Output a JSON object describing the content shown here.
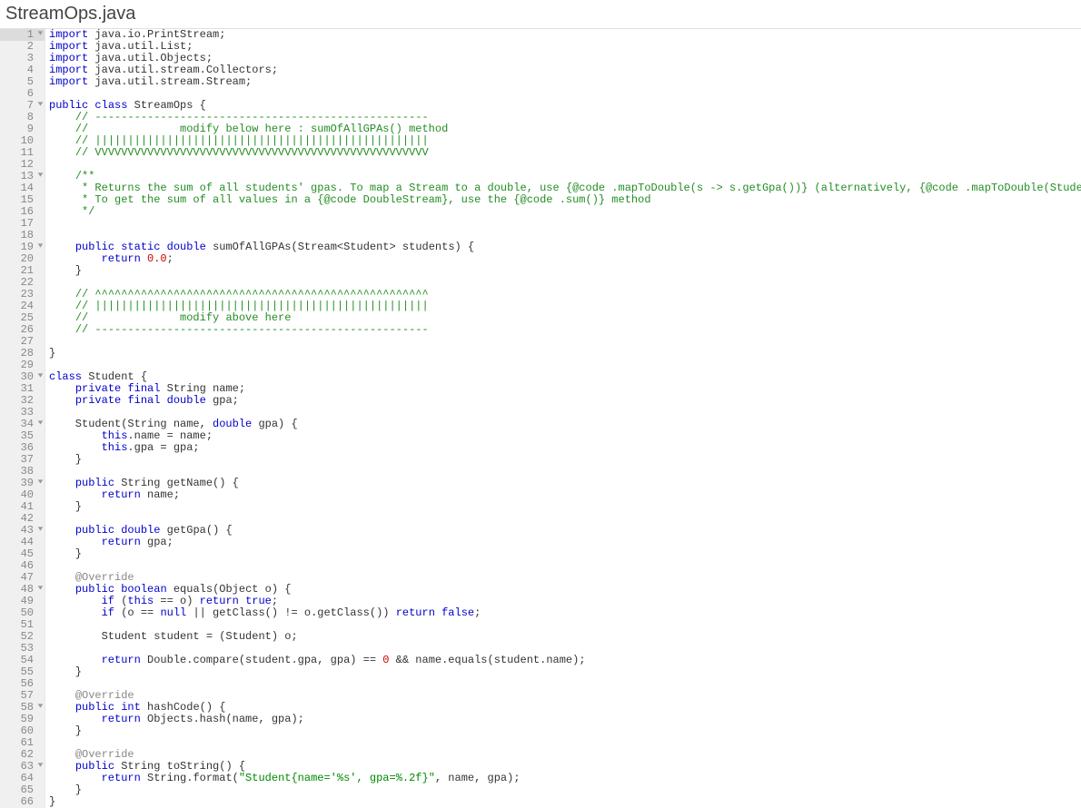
{
  "page_title": "StreamOps.java",
  "active_line": 1,
  "lines": [
    {
      "n": 1,
      "fold": true,
      "tokens": [
        [
          "kw",
          "import"
        ],
        [
          "pl",
          " java.io.PrintStream;"
        ]
      ]
    },
    {
      "n": 2,
      "fold": false,
      "tokens": [
        [
          "kw",
          "import"
        ],
        [
          "pl",
          " java.util.List;"
        ]
      ]
    },
    {
      "n": 3,
      "fold": false,
      "tokens": [
        [
          "kw",
          "import"
        ],
        [
          "pl",
          " java.util.Objects;"
        ]
      ]
    },
    {
      "n": 4,
      "fold": false,
      "tokens": [
        [
          "kw",
          "import"
        ],
        [
          "pl",
          " java.util.stream.Collectors;"
        ]
      ]
    },
    {
      "n": 5,
      "fold": false,
      "tokens": [
        [
          "kw",
          "import"
        ],
        [
          "pl",
          " java.util.stream.Stream;"
        ]
      ]
    },
    {
      "n": 6,
      "fold": false,
      "tokens": []
    },
    {
      "n": 7,
      "fold": true,
      "tokens": [
        [
          "kw",
          "public"
        ],
        [
          "pl",
          " "
        ],
        [
          "kw",
          "class"
        ],
        [
          "pl",
          " StreamOps {"
        ]
      ]
    },
    {
      "n": 8,
      "fold": false,
      "tokens": [
        [
          "pl",
          "    "
        ],
        [
          "cmt",
          "// ---------------------------------------------------"
        ]
      ]
    },
    {
      "n": 9,
      "fold": false,
      "tokens": [
        [
          "pl",
          "    "
        ],
        [
          "cmt",
          "//              modify below here : sumOfAllGPAs() method"
        ]
      ]
    },
    {
      "n": 10,
      "fold": false,
      "tokens": [
        [
          "pl",
          "    "
        ],
        [
          "cmt",
          "// |||||||||||||||||||||||||||||||||||||||||||||||||||"
        ]
      ]
    },
    {
      "n": 11,
      "fold": false,
      "tokens": [
        [
          "pl",
          "    "
        ],
        [
          "cmt",
          "// VVVVVVVVVVVVVVVVVVVVVVVVVVVVVVVVVVVVVVVVVVVVVVVVVVV"
        ]
      ]
    },
    {
      "n": 12,
      "fold": false,
      "tokens": []
    },
    {
      "n": 13,
      "fold": true,
      "tokens": [
        [
          "pl",
          "    "
        ],
        [
          "cmt",
          "/**"
        ]
      ]
    },
    {
      "n": 14,
      "fold": false,
      "tokens": [
        [
          "pl",
          "     "
        ],
        [
          "cmt",
          "* Returns the sum of all students' gpas. To map a Stream to a double, use {@code .mapToDouble(s -> s.getGpa())} (alternatively, {@code .mapToDouble(Student::getGpa)})."
        ]
      ]
    },
    {
      "n": 15,
      "fold": false,
      "tokens": [
        [
          "pl",
          "     "
        ],
        [
          "cmt",
          "* To get the sum of all values in a {@code DoubleStream}, use the {@code .sum()} method"
        ]
      ]
    },
    {
      "n": 16,
      "fold": false,
      "tokens": [
        [
          "pl",
          "     "
        ],
        [
          "cmt",
          "*/"
        ]
      ]
    },
    {
      "n": 17,
      "fold": false,
      "tokens": []
    },
    {
      "n": 18,
      "fold": false,
      "tokens": []
    },
    {
      "n": 19,
      "fold": true,
      "tokens": [
        [
          "pl",
          "    "
        ],
        [
          "kw",
          "public"
        ],
        [
          "pl",
          " "
        ],
        [
          "kw",
          "static"
        ],
        [
          "pl",
          " "
        ],
        [
          "kw",
          "double"
        ],
        [
          "pl",
          " sumOfAllGPAs(Stream<Student> students) {"
        ]
      ]
    },
    {
      "n": 20,
      "fold": false,
      "tokens": [
        [
          "pl",
          "        "
        ],
        [
          "kw",
          "return"
        ],
        [
          "pl",
          " "
        ],
        [
          "num",
          "0.0"
        ],
        [
          "pl",
          ";"
        ]
      ]
    },
    {
      "n": 21,
      "fold": false,
      "tokens": [
        [
          "pl",
          "    }"
        ]
      ]
    },
    {
      "n": 22,
      "fold": false,
      "tokens": []
    },
    {
      "n": 23,
      "fold": false,
      "tokens": [
        [
          "pl",
          "    "
        ],
        [
          "cmt",
          "// ^^^^^^^^^^^^^^^^^^^^^^^^^^^^^^^^^^^^^^^^^^^^^^^^^^^"
        ]
      ]
    },
    {
      "n": 24,
      "fold": false,
      "tokens": [
        [
          "pl",
          "    "
        ],
        [
          "cmt",
          "// |||||||||||||||||||||||||||||||||||||||||||||||||||"
        ]
      ]
    },
    {
      "n": 25,
      "fold": false,
      "tokens": [
        [
          "pl",
          "    "
        ],
        [
          "cmt",
          "//              modify above here"
        ]
      ]
    },
    {
      "n": 26,
      "fold": false,
      "tokens": [
        [
          "pl",
          "    "
        ],
        [
          "cmt",
          "// ---------------------------------------------------"
        ]
      ]
    },
    {
      "n": 27,
      "fold": false,
      "tokens": []
    },
    {
      "n": 28,
      "fold": false,
      "tokens": [
        [
          "pl",
          "}"
        ]
      ]
    },
    {
      "n": 29,
      "fold": false,
      "tokens": []
    },
    {
      "n": 30,
      "fold": true,
      "tokens": [
        [
          "kw",
          "class"
        ],
        [
          "pl",
          " Student {"
        ]
      ]
    },
    {
      "n": 31,
      "fold": false,
      "tokens": [
        [
          "pl",
          "    "
        ],
        [
          "kw",
          "private"
        ],
        [
          "pl",
          " "
        ],
        [
          "kw",
          "final"
        ],
        [
          "pl",
          " String name;"
        ]
      ]
    },
    {
      "n": 32,
      "fold": false,
      "tokens": [
        [
          "pl",
          "    "
        ],
        [
          "kw",
          "private"
        ],
        [
          "pl",
          " "
        ],
        [
          "kw",
          "final"
        ],
        [
          "pl",
          " "
        ],
        [
          "kw",
          "double"
        ],
        [
          "pl",
          " gpa;"
        ]
      ]
    },
    {
      "n": 33,
      "fold": false,
      "tokens": []
    },
    {
      "n": 34,
      "fold": true,
      "tokens": [
        [
          "pl",
          "    Student(String name, "
        ],
        [
          "kw",
          "double"
        ],
        [
          "pl",
          " gpa) {"
        ]
      ]
    },
    {
      "n": 35,
      "fold": false,
      "tokens": [
        [
          "pl",
          "        "
        ],
        [
          "kw",
          "this"
        ],
        [
          "pl",
          ".name = name;"
        ]
      ]
    },
    {
      "n": 36,
      "fold": false,
      "tokens": [
        [
          "pl",
          "        "
        ],
        [
          "kw",
          "this"
        ],
        [
          "pl",
          ".gpa = gpa;"
        ]
      ]
    },
    {
      "n": 37,
      "fold": false,
      "tokens": [
        [
          "pl",
          "    }"
        ]
      ]
    },
    {
      "n": 38,
      "fold": false,
      "tokens": []
    },
    {
      "n": 39,
      "fold": true,
      "tokens": [
        [
          "pl",
          "    "
        ],
        [
          "kw",
          "public"
        ],
        [
          "pl",
          " String getName() {"
        ]
      ]
    },
    {
      "n": 40,
      "fold": false,
      "tokens": [
        [
          "pl",
          "        "
        ],
        [
          "kw",
          "return"
        ],
        [
          "pl",
          " name;"
        ]
      ]
    },
    {
      "n": 41,
      "fold": false,
      "tokens": [
        [
          "pl",
          "    }"
        ]
      ]
    },
    {
      "n": 42,
      "fold": false,
      "tokens": []
    },
    {
      "n": 43,
      "fold": true,
      "tokens": [
        [
          "pl",
          "    "
        ],
        [
          "kw",
          "public"
        ],
        [
          "pl",
          " "
        ],
        [
          "kw",
          "double"
        ],
        [
          "pl",
          " getGpa() {"
        ]
      ]
    },
    {
      "n": 44,
      "fold": false,
      "tokens": [
        [
          "pl",
          "        "
        ],
        [
          "kw",
          "return"
        ],
        [
          "pl",
          " gpa;"
        ]
      ]
    },
    {
      "n": 45,
      "fold": false,
      "tokens": [
        [
          "pl",
          "    }"
        ]
      ]
    },
    {
      "n": 46,
      "fold": false,
      "tokens": []
    },
    {
      "n": 47,
      "fold": false,
      "tokens": [
        [
          "pl",
          "    "
        ],
        [
          "ann",
          "@Override"
        ]
      ]
    },
    {
      "n": 48,
      "fold": true,
      "tokens": [
        [
          "pl",
          "    "
        ],
        [
          "kw",
          "public"
        ],
        [
          "pl",
          " "
        ],
        [
          "kw",
          "boolean"
        ],
        [
          "pl",
          " equals(Object o) {"
        ]
      ]
    },
    {
      "n": 49,
      "fold": false,
      "tokens": [
        [
          "pl",
          "        "
        ],
        [
          "kw",
          "if"
        ],
        [
          "pl",
          " ("
        ],
        [
          "kw",
          "this"
        ],
        [
          "pl",
          " == o) "
        ],
        [
          "kw",
          "return"
        ],
        [
          "pl",
          " "
        ],
        [
          "kw",
          "true"
        ],
        [
          "pl",
          ";"
        ]
      ]
    },
    {
      "n": 50,
      "fold": false,
      "tokens": [
        [
          "pl",
          "        "
        ],
        [
          "kw",
          "if"
        ],
        [
          "pl",
          " (o == "
        ],
        [
          "kw",
          "null"
        ],
        [
          "pl",
          " || getClass() != o.getClass()) "
        ],
        [
          "kw",
          "return"
        ],
        [
          "pl",
          " "
        ],
        [
          "kw",
          "false"
        ],
        [
          "pl",
          ";"
        ]
      ]
    },
    {
      "n": 51,
      "fold": false,
      "tokens": []
    },
    {
      "n": 52,
      "fold": false,
      "tokens": [
        [
          "pl",
          "        Student student = (Student) o;"
        ]
      ]
    },
    {
      "n": 53,
      "fold": false,
      "tokens": []
    },
    {
      "n": 54,
      "fold": false,
      "tokens": [
        [
          "pl",
          "        "
        ],
        [
          "kw",
          "return"
        ],
        [
          "pl",
          " Double.compare(student.gpa, gpa) == "
        ],
        [
          "num",
          "0"
        ],
        [
          "pl",
          " && name.equals(student.name);"
        ]
      ]
    },
    {
      "n": 55,
      "fold": false,
      "tokens": [
        [
          "pl",
          "    }"
        ]
      ]
    },
    {
      "n": 56,
      "fold": false,
      "tokens": []
    },
    {
      "n": 57,
      "fold": false,
      "tokens": [
        [
          "pl",
          "    "
        ],
        [
          "ann",
          "@Override"
        ]
      ]
    },
    {
      "n": 58,
      "fold": true,
      "tokens": [
        [
          "pl",
          "    "
        ],
        [
          "kw",
          "public"
        ],
        [
          "pl",
          " "
        ],
        [
          "kw",
          "int"
        ],
        [
          "pl",
          " hashCode() {"
        ]
      ]
    },
    {
      "n": 59,
      "fold": false,
      "tokens": [
        [
          "pl",
          "        "
        ],
        [
          "kw",
          "return"
        ],
        [
          "pl",
          " Objects.hash(name, gpa);"
        ]
      ]
    },
    {
      "n": 60,
      "fold": false,
      "tokens": [
        [
          "pl",
          "    }"
        ]
      ]
    },
    {
      "n": 61,
      "fold": false,
      "tokens": []
    },
    {
      "n": 62,
      "fold": false,
      "tokens": [
        [
          "pl",
          "    "
        ],
        [
          "ann",
          "@Override"
        ]
      ]
    },
    {
      "n": 63,
      "fold": true,
      "tokens": [
        [
          "pl",
          "    "
        ],
        [
          "kw",
          "public"
        ],
        [
          "pl",
          " String toString() {"
        ]
      ]
    },
    {
      "n": 64,
      "fold": false,
      "tokens": [
        [
          "pl",
          "        "
        ],
        [
          "kw",
          "return"
        ],
        [
          "pl",
          " String.format("
        ],
        [
          "str",
          "\"Student{name='%s', gpa=%.2f}\""
        ],
        [
          "pl",
          ", name, gpa);"
        ]
      ]
    },
    {
      "n": 65,
      "fold": false,
      "tokens": [
        [
          "pl",
          "    }"
        ]
      ]
    },
    {
      "n": 66,
      "fold": false,
      "tokens": [
        [
          "pl",
          "}"
        ]
      ]
    }
  ]
}
